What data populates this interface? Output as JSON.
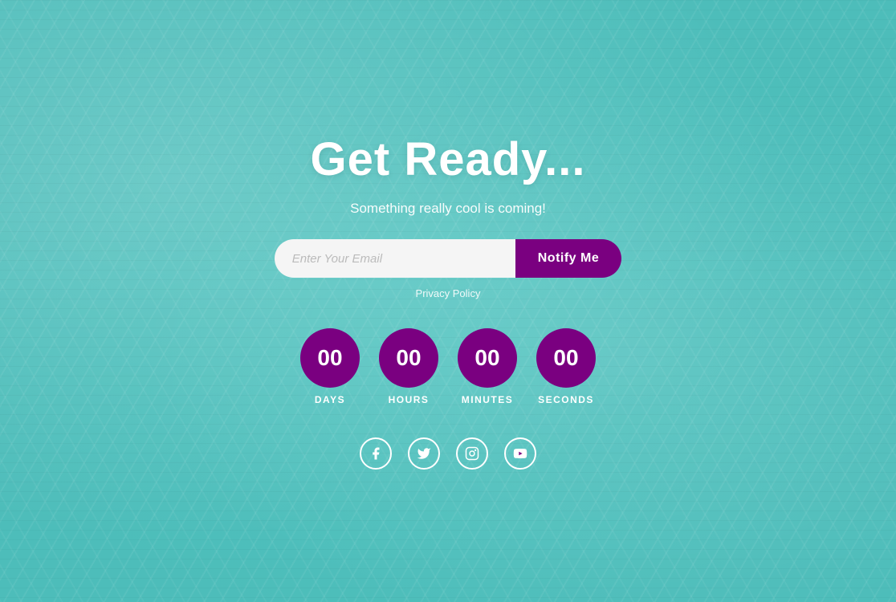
{
  "page": {
    "title": "Get Ready...",
    "subtitle": "Something really cool is coming!",
    "colors": {
      "accent": "#7a0080",
      "background": "#4dbdba",
      "text_white": "#ffffff"
    }
  },
  "email_form": {
    "placeholder": "Enter Your Email",
    "button_label": "Notify Me"
  },
  "privacy": {
    "label": "Privacy Policy"
  },
  "countdown": {
    "items": [
      {
        "value": "00",
        "label": "DAYS"
      },
      {
        "value": "00",
        "label": "HOURS"
      },
      {
        "value": "00",
        "label": "MINUTES"
      },
      {
        "value": "00",
        "label": "SECONDS"
      }
    ]
  },
  "social": {
    "items": [
      {
        "name": "facebook",
        "label": "Facebook"
      },
      {
        "name": "twitter",
        "label": "Twitter"
      },
      {
        "name": "instagram",
        "label": "Instagram"
      },
      {
        "name": "youtube",
        "label": "YouTube"
      }
    ]
  }
}
